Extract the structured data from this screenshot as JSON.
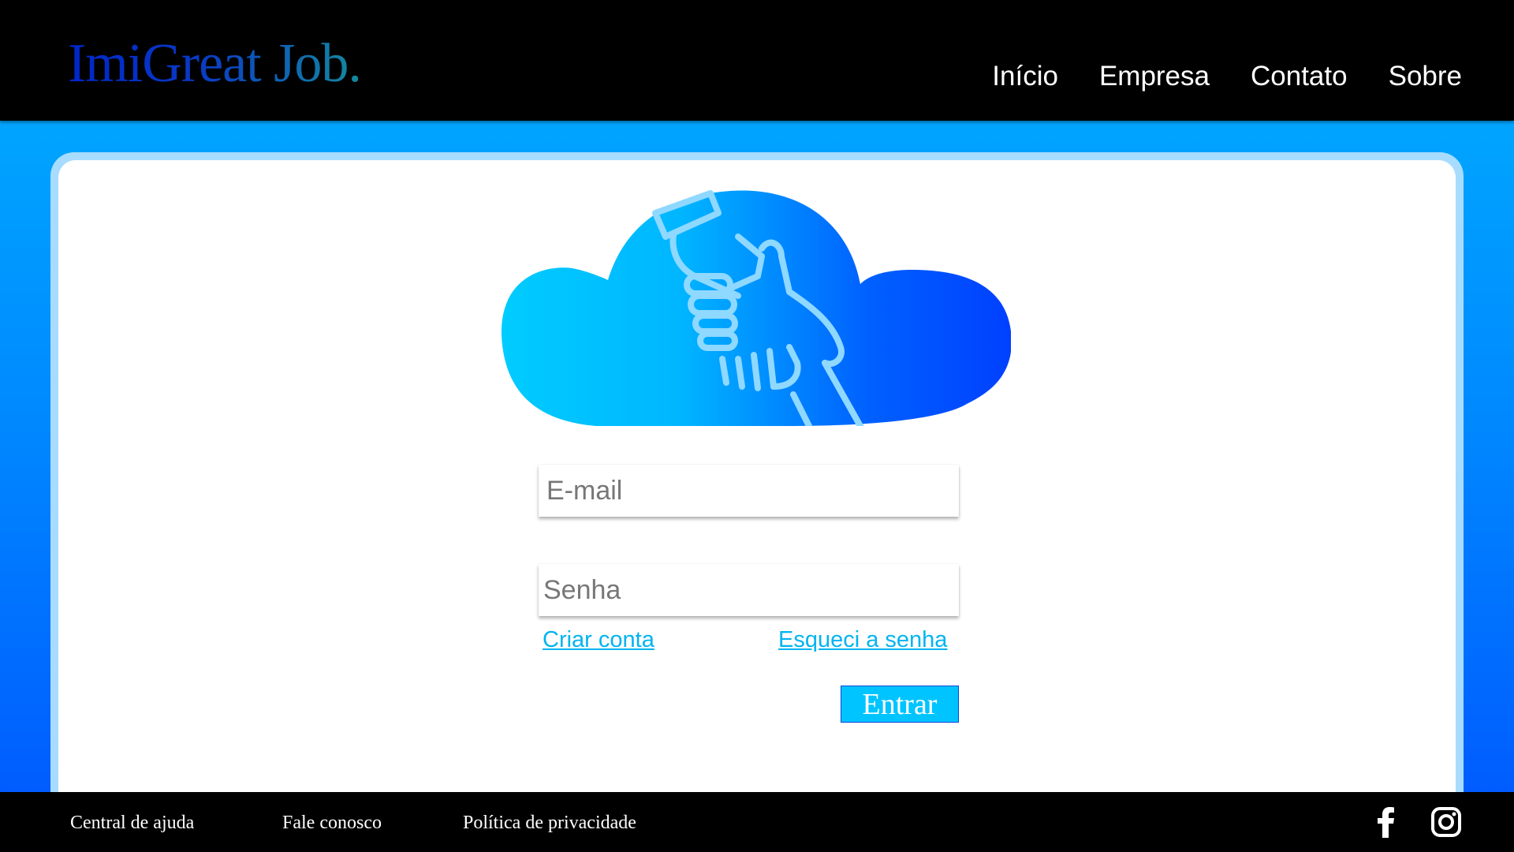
{
  "brand": {
    "logo_text": "ImiGreat Job."
  },
  "nav": {
    "items": [
      {
        "label": "Início"
      },
      {
        "label": "Empresa"
      },
      {
        "label": "Contato"
      },
      {
        "label": "Sobre"
      }
    ]
  },
  "login": {
    "email_placeholder": "E-mail",
    "password_placeholder": "Senha",
    "create_account": "Criar conta",
    "forgot_password": "Esqueci a senha",
    "submit_label": "Entrar"
  },
  "footer": {
    "links": [
      {
        "label": "Central de ajuda"
      },
      {
        "label": "Fale conosco"
      },
      {
        "label": "Política de privacidade"
      }
    ],
    "social": [
      "facebook-icon",
      "instagram-icon"
    ]
  },
  "colors": {
    "header_bg": "#000000",
    "accent": "#00c4ff",
    "link": "#00b4f0",
    "page_gradient_top": "#00b0ff",
    "page_gradient_bottom": "#0055ff"
  }
}
